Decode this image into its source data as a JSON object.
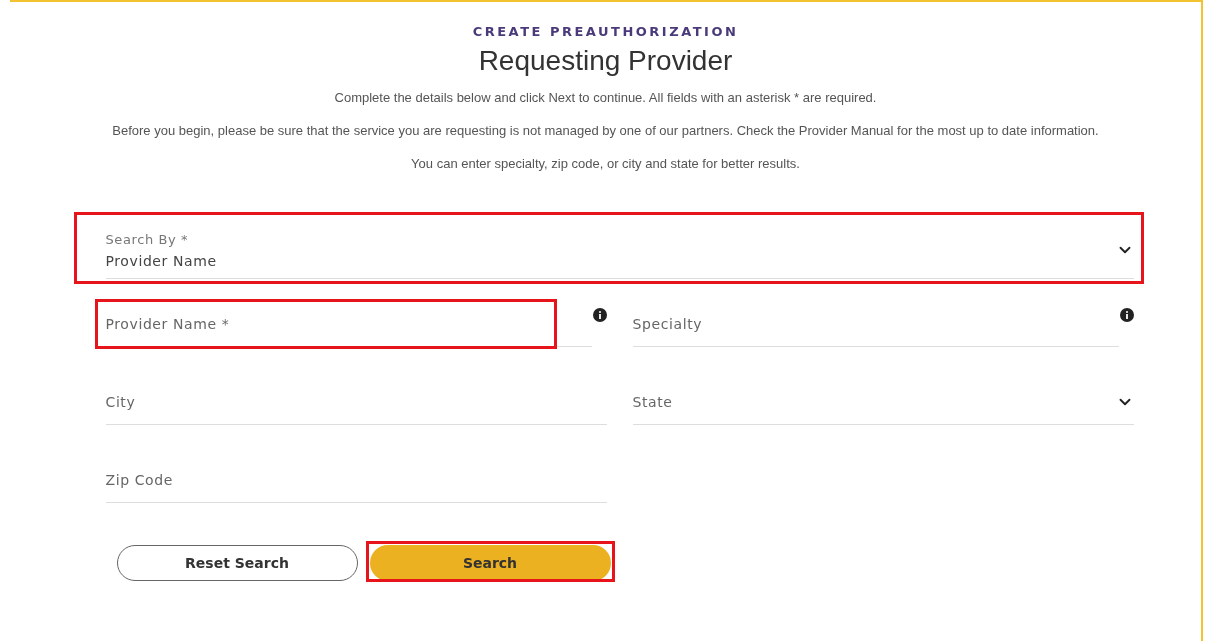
{
  "eyebrow": "CREATE PREAUTHORIZATION",
  "title": "Requesting Provider",
  "paragraphs": [
    "Complete the details below and click Next to continue. All fields with an asterisk * are required.",
    "Before you begin, please be sure that the service you are requesting is not managed by one of our partners. Check the Provider Manual for the most up to date information.",
    "You can enter specialty, zip code, or city and state for better results."
  ],
  "search_by": {
    "label": "Search By *",
    "value": "Provider Name",
    "highlighted": true
  },
  "fields": [
    {
      "kind": "text",
      "label": "Provider Name *",
      "info": true,
      "highlighted": true
    },
    {
      "kind": "text",
      "label": "Specialty",
      "info": true,
      "highlighted": false
    },
    {
      "kind": "text",
      "label": "City",
      "info": false,
      "highlighted": false
    },
    {
      "kind": "select",
      "label": "State",
      "info": false,
      "highlighted": false
    },
    {
      "kind": "text",
      "label": "Zip Code",
      "info": false,
      "highlighted": false
    }
  ],
  "buttons": [
    {
      "kind": "secondary",
      "label": "Reset Search",
      "highlighted": false
    },
    {
      "kind": "primary",
      "label": "Search",
      "highlighted": true
    }
  ]
}
